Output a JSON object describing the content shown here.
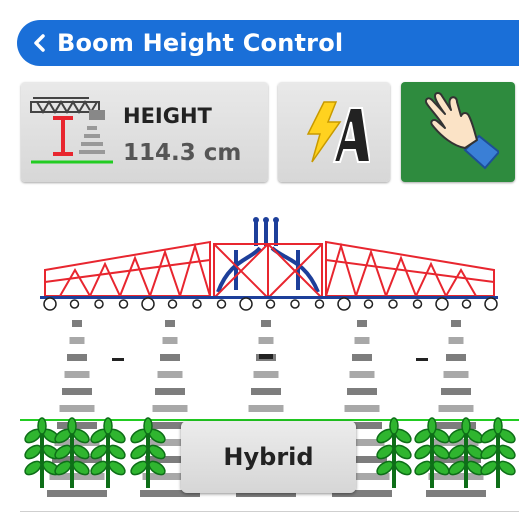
{
  "header": {
    "title": "Boom Height Control"
  },
  "height_tile": {
    "label": "HEIGHT",
    "value": "114.3 cm"
  },
  "mode_button": {
    "label": "Hybrid"
  },
  "colors": {
    "header_blue": "#1a6fd8",
    "boom_red": "#e8262f",
    "manual_active_green": "#2e8b3e",
    "ground_green": "#22cc22"
  },
  "icons": {
    "back": "chevron-left-icon",
    "height": "boom-height-icon",
    "auto": "auto-lightning-icon",
    "manual": "hand-icon"
  }
}
